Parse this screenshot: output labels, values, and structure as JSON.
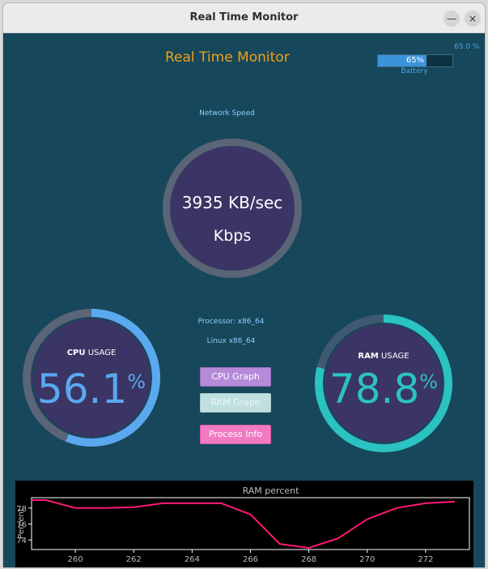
{
  "window": {
    "title": "Real Time Monitor",
    "minimize_glyph": "—",
    "close_glyph": "×"
  },
  "app": {
    "title": "Real Time Monitor"
  },
  "battery": {
    "percent_text": "65.0 %",
    "bar_label": "65%",
    "label": "Battery",
    "level": 0.65,
    "fill_color": "#3a94d8"
  },
  "network": {
    "label": "Network Speed",
    "speed": "3935 KB/sec",
    "unit": "Kbps"
  },
  "cpu": {
    "title_bold": "CPU",
    "title_rest": " USAGE",
    "value": "56.1",
    "unit": "%",
    "percent": 56.1,
    "color": "#5aa8f0",
    "track_color": "#5a6577"
  },
  "ram": {
    "title_bold": "RAM",
    "title_rest": " USAGE",
    "value": "78.8",
    "unit": "%",
    "percent": 78.8,
    "color": "#2bc2c2",
    "track_color": "#3f5a70"
  },
  "system": {
    "processor": "Processor: x86_64",
    "os": "Linux x86_64"
  },
  "buttons": {
    "cpu_graph": "CPU Graph",
    "ram_graph": "RAM Graph",
    "process_info": "Process Info"
  },
  "chart_data": {
    "type": "line",
    "title": "RAM percent",
    "xlabel": "",
    "ylabel": "Percent",
    "xlim": [
      258.5,
      273.5
    ],
    "ylim": [
      72.8,
      79.3
    ],
    "xticks": [
      260,
      262,
      264,
      266,
      268,
      270,
      272
    ],
    "yticks": [
      74,
      76,
      78
    ],
    "grid": false,
    "line_color": "#ff1a75",
    "series": [
      {
        "x": [
          258.5,
          259,
          260,
          261,
          262,
          263,
          264,
          265,
          266,
          267,
          268,
          269,
          270,
          271,
          272,
          273
        ],
        "y": [
          79.0,
          79.0,
          78.0,
          78.0,
          78.1,
          78.6,
          78.6,
          78.6,
          77.2,
          73.5,
          73.0,
          74.2,
          76.6,
          78.0,
          78.6,
          78.8
        ]
      }
    ]
  }
}
